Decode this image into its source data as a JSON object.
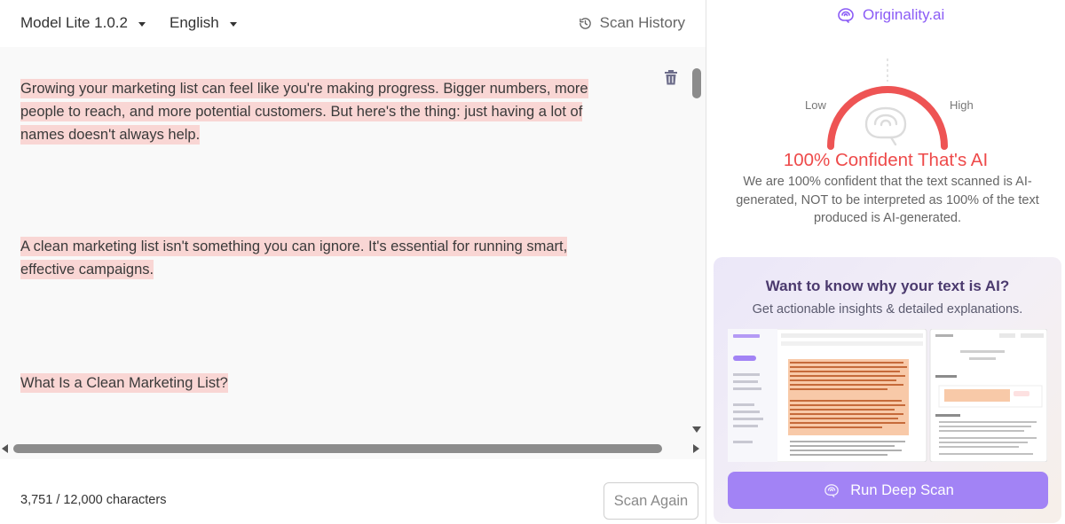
{
  "header": {
    "model_label": "Model Lite 1.0.2",
    "language_label": "English",
    "history_label": "Scan History"
  },
  "editor": {
    "paragraphs": [
      "Growing your marketing list can feel like you're making progress. Bigger numbers, more people to reach, and more potential customers. But here's the thing: just having a lot of names doesn't always help.",
      "A clean marketing list isn't something you can ignore. It's essential for running smart, effective campaigns.",
      "What Is a Clean Marketing List?"
    ],
    "highlight_color": "#f9d6d4",
    "char_count": "3,751 / 12,000 characters",
    "scan_again_label": "Scan Again"
  },
  "result": {
    "brand": "Originality.ai",
    "gauge_low": "Low",
    "gauge_high": "High",
    "gauge_value_percent": 100,
    "verdict": "100% Confident That's AI",
    "description": "We are 100% confident that the text scanned is AI-generated, NOT to be interpreted as 100% of the text produced is AI-generated.",
    "accent_color": "#ee4a4a",
    "brand_color": "#8b5cf6"
  },
  "promo": {
    "title": "Want to know why your text is AI?",
    "subtitle": "Get actionable insights & detailed explanations.",
    "button_label": "Run Deep Scan",
    "button_color": "#a283f5"
  },
  "icons": {
    "history": "history-icon",
    "trash": "trash-icon",
    "brain": "brain-icon",
    "caret": "chevron-down-icon"
  }
}
